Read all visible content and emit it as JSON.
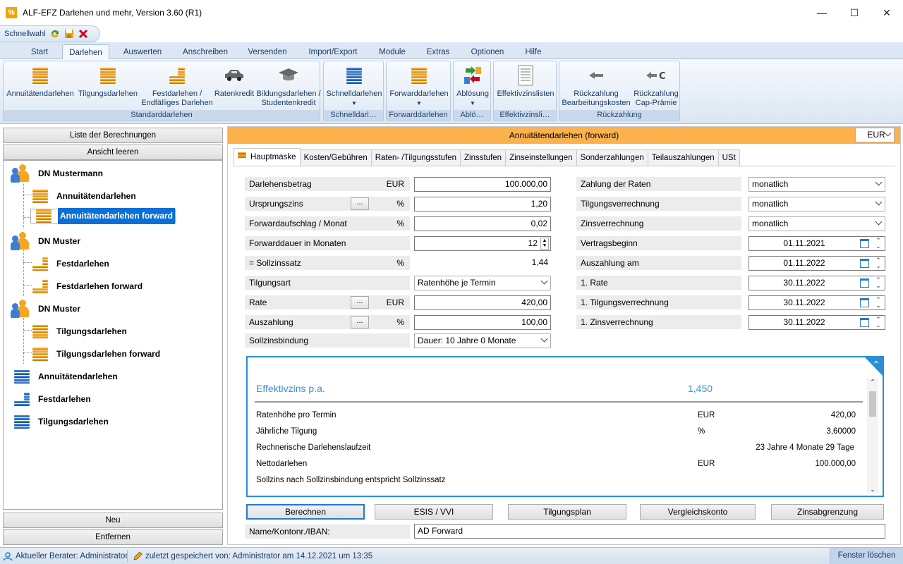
{
  "window": {
    "title": "ALF-EFZ Darlehen und mehr, Version 3.60 (R1)",
    "app_icon_glyph": "%"
  },
  "qat": {
    "label": "Schnellwahl",
    "icons": [
      "refresh-icon",
      "save-icon",
      "delete-icon"
    ]
  },
  "tabs": [
    "Start",
    "Darlehen",
    "Auswerten",
    "Anschreiben",
    "Versenden",
    "Import/Export",
    "Module",
    "Extras",
    "Optionen",
    "Hilfe"
  ],
  "active_tab": "Darlehen",
  "ribbon": {
    "groups": [
      {
        "label": "Standarddarlehen",
        "buttons": [
          "Annuitätendarlehen",
          "Tilgungsdarlehen",
          "Festdarlehen / Endfälliges Darlehen",
          "Ratenkredit",
          "Bildungsdarlehen / Studentenkredit"
        ]
      },
      {
        "label": "Schnelldarl…",
        "buttons": [
          "Schnelldarlehen"
        ]
      },
      {
        "label": "Forwarddarlehen",
        "buttons": [
          "Forwarddarlehen"
        ]
      },
      {
        "label": "Ablö…",
        "buttons": [
          "Ablösung"
        ]
      },
      {
        "label": "Effektivzinsli…",
        "buttons": [
          "Effektivzinslisten"
        ]
      },
      {
        "label": "Rückzahlung",
        "buttons": [
          "Rückzahlung Bearbeitungskosten",
          "Rückzahlung Cap-Prämie"
        ]
      }
    ]
  },
  "left": {
    "btn_list": "Liste der Berechnungen",
    "btn_clear": "Ansicht leeren",
    "btn_new": "Neu",
    "btn_remove": "Entfernen",
    "tree": [
      {
        "label": "DN Mustermann",
        "type": "person"
      },
      {
        "label": "Annuitätendarlehen",
        "type": "orange"
      },
      {
        "label": "Annuitätendarlehen forward",
        "type": "orange-fwd",
        "selected": true
      },
      {
        "label": "DN Muster",
        "type": "person"
      },
      {
        "label": "Festdarlehen",
        "type": "orange-fest"
      },
      {
        "label": "Festdarlehen forward",
        "type": "orange-fest-fwd"
      },
      {
        "label": "DN Muster",
        "type": "person"
      },
      {
        "label": "Tilgungsdarlehen",
        "type": "orange"
      },
      {
        "label": "Tilgungsdarlehen forward",
        "type": "orange-fwd"
      },
      {
        "label": "Annuitätendarlehen",
        "type": "blue"
      },
      {
        "label": "Festdarlehen",
        "type": "blue"
      },
      {
        "label": "Tilgungsdarlehen",
        "type": "blue"
      }
    ]
  },
  "right": {
    "header": "Annuitätendarlehen (forward)",
    "currency": "EUR",
    "subtabs": [
      "Hauptmaske",
      "Kosten/Gebühren",
      "Raten- /Tilgungsstufen",
      "Zinsstufen",
      "Zinseinstellungen",
      "Sonderzahlungen",
      "Teilauszahlungen",
      "USt"
    ],
    "fields": {
      "darlehensbetrag": {
        "label": "Darlehensbetrag",
        "unit": "EUR",
        "value": "100.000,00"
      },
      "ursprungszins": {
        "label": "Ursprungszins",
        "unit": "%",
        "value": "1,20",
        "dots": "..."
      },
      "forwardaufschlag": {
        "label": "Forwardaufschlag / Monat",
        "unit": "%",
        "value": "0,02"
      },
      "forwarddauer": {
        "label": "Forwarddauer in Monaten",
        "value": "12"
      },
      "sollzinssatz": {
        "label": "= Sollzinssatz",
        "unit": "%",
        "value": "1,44"
      },
      "tilgungsart": {
        "label": "Tilgungsart",
        "value": "Ratenhöhe je Termin"
      },
      "rate": {
        "label": "Rate",
        "unit": "EUR",
        "value": "420,00",
        "dots": "..."
      },
      "auszahlung": {
        "label": "Auszahlung",
        "unit": "%",
        "value": "100,00",
        "dots": "..."
      },
      "sollzinsbindung": {
        "label": "Sollzinsbindung",
        "value": "Dauer: 10 Jahre 0 Monate"
      },
      "zahlung_raten": {
        "label": "Zahlung der Raten",
        "value": "monatlich"
      },
      "tilgungsverrechnung": {
        "label": "Tilgungsverrechnung",
        "value": "monatlich"
      },
      "zinsverrechnung": {
        "label": "Zinsverrechnung",
        "value": "monatlich"
      },
      "vertragsbeginn": {
        "label": "Vertragsbeginn",
        "value": "01.11.2021"
      },
      "auszahlung_am": {
        "label": "Auszahlung am",
        "value": "01.11.2022"
      },
      "erste_rate": {
        "label": "1. Rate",
        "value": "30.11.2022"
      },
      "erste_tilgung": {
        "label": "1. Tilgungsverrechnung",
        "value": "30.11.2022"
      },
      "erste_zins": {
        "label": "1. Zinsverrechnung",
        "value": "30.11.2022"
      }
    },
    "effektiv": {
      "title": "Effektivzins p.a.",
      "value": "1,450",
      "rows": [
        {
          "label": "Ratenhöhe pro Termin",
          "unit": "EUR",
          "value": "420,00"
        },
        {
          "label": "Jährliche Tilgung",
          "unit": "%",
          "value": "3,60000"
        },
        {
          "label": "Rechnerische Darlehenslaufzeit",
          "unit": "",
          "value": "23 Jahre 4 Monate 29 Tage"
        },
        {
          "label": "Nettodarlehen",
          "unit": "EUR",
          "value": "100.000,00"
        },
        {
          "label": "Sollzins nach Sollzinsbindung entspricht Sollzinssatz",
          "unit": "",
          "value": ""
        }
      ]
    },
    "actions": [
      "Berechnen",
      "ESIS / VVI",
      "Tilgungsplan",
      "Vergleichskonto",
      "Zinsabgrenzung"
    ],
    "name_label": "Name/Kontonr./IBAN:",
    "name_value": "AD Forward"
  },
  "status": {
    "berater": "Aktueller Berater: Administrator",
    "saved": "zuletzt gespeichert von: Administrator am 14.12.2021 um 13:35",
    "window_delete": "Fenster löschen"
  }
}
